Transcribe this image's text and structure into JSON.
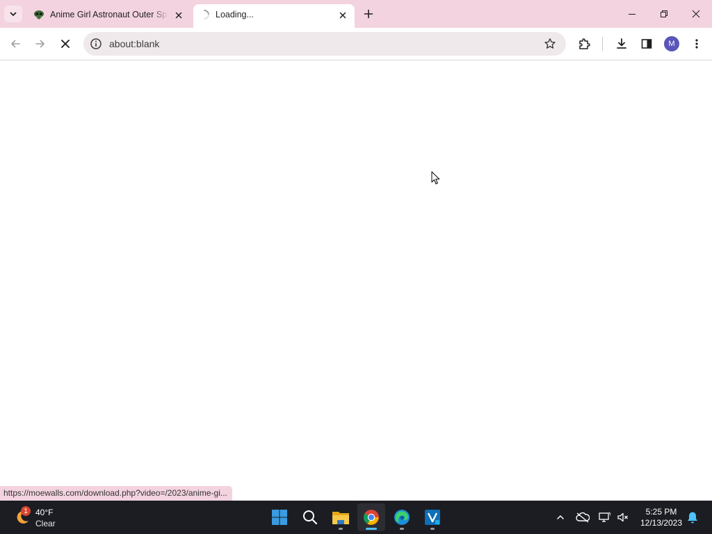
{
  "tabs": [
    {
      "title": "Anime Girl Astronaut Outer Space",
      "state": "inactive",
      "favicon": "alien-favicon-icon"
    },
    {
      "title": "Loading...",
      "state": "active",
      "favicon": "loading-spinner-icon"
    }
  ],
  "toolbar": {
    "url": "about:blank",
    "profile_initial": "M"
  },
  "status_bubble": {
    "text": "https://moewalls.com/download.php?video=/2023/anime-gi..."
  },
  "taskbar": {
    "weather": {
      "temperature": "40°F",
      "condition": "Clear",
      "badge": "1"
    },
    "apps": [
      "start",
      "search",
      "file-explorer",
      "chrome",
      "edge",
      "visio"
    ],
    "clock": {
      "time": "5:25 PM",
      "date": "12/13/2023"
    }
  },
  "colors": {
    "tabstrip_bg": "#f3d3df",
    "omnibox_bg": "#efe9ec",
    "taskbar_bg": "#1c1d22",
    "accent": "#4cc2ff"
  }
}
